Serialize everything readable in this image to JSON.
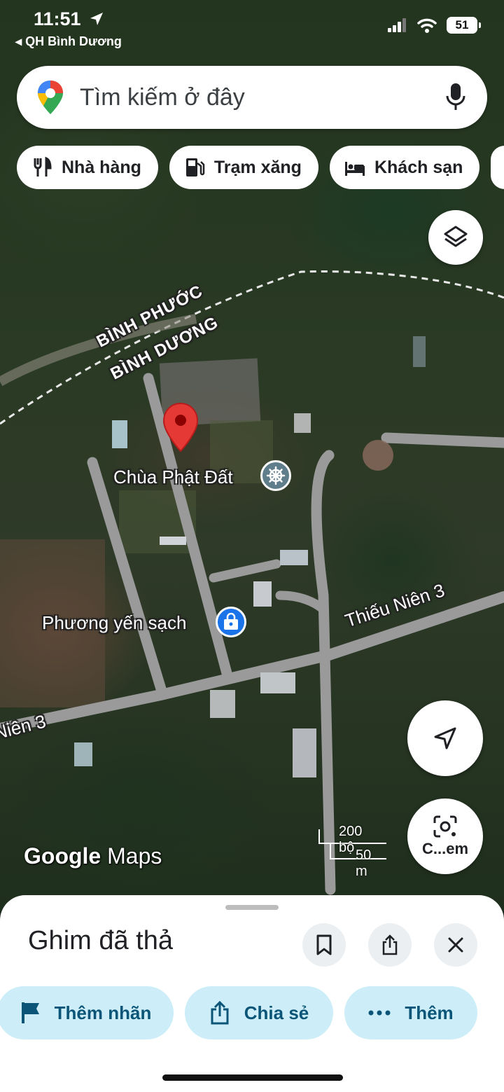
{
  "status_bar": {
    "time": "11:51",
    "back_app": "QH Bình Dương",
    "battery": "51"
  },
  "search": {
    "placeholder": "Tìm kiếm ở đây"
  },
  "chips": [
    {
      "label": "Nhà hàng",
      "icon": "restaurant-icon"
    },
    {
      "label": "Trạm xăng",
      "icon": "gas-station-icon"
    },
    {
      "label": "Khách sạn",
      "icon": "hotel-icon"
    }
  ],
  "map": {
    "border_top": "BÌNH PHƯỚC",
    "border_bottom": "BÌNH DƯƠNG",
    "poi_1": "Chùa Phật Đất",
    "poi_2": "Phương yến sạch",
    "road_1": "Thiếu Niên 3",
    "road_2": "Niên 3",
    "scale_feet": "200 bộ",
    "scale_m": "50 m",
    "logo_google": "Google",
    "logo_maps": "Maps",
    "lens_label": "C...em",
    "pin_color": "#e53935"
  },
  "sheet": {
    "title": "Ghim đã thả",
    "actions": [
      {
        "label": "Thêm nhãn",
        "icon": "flag-icon"
      },
      {
        "label": "Chia sẻ",
        "icon": "share-icon"
      },
      {
        "label": "Thêm",
        "icon": "more-icon"
      }
    ]
  },
  "colors": {
    "accent_pill": "#cdeef8",
    "accent_text": "#0b5578"
  }
}
